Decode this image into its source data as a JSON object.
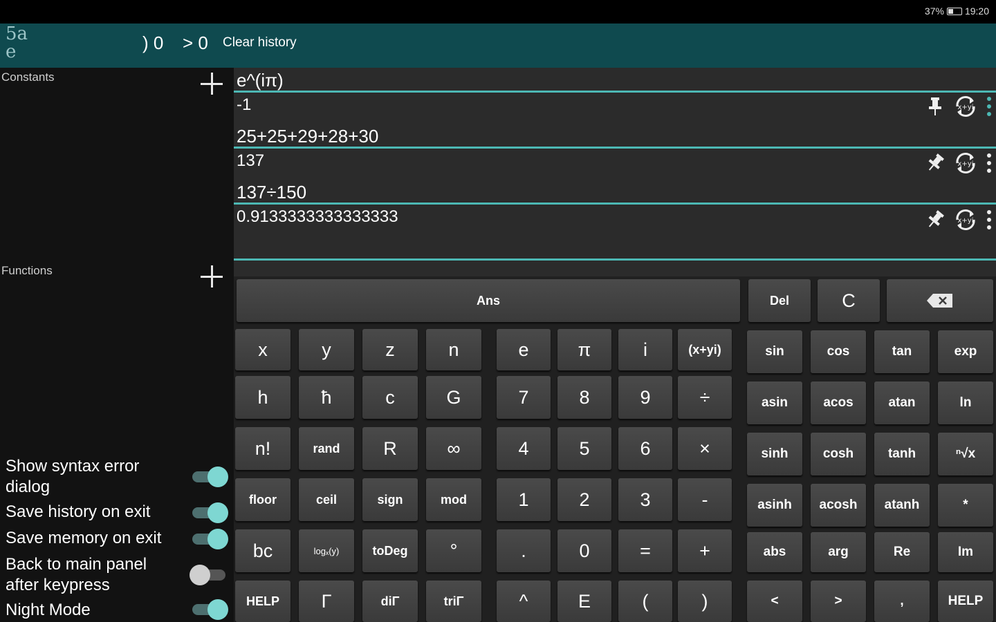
{
  "status": {
    "battery": "37%",
    "time": "19:20"
  },
  "toolbar": {
    "logo_line1": "5a",
    "logo_line2": "e",
    "paren_counter": ") 0",
    "greater_counter": "> 0",
    "clear_history": "Clear history"
  },
  "drawer": {
    "constants_title": "Constants",
    "functions_title": "Functions",
    "settings": [
      {
        "label": "Show syntax error dialog",
        "on": true
      },
      {
        "label": "Save history on exit",
        "on": true
      },
      {
        "label": "Save memory on exit",
        "on": true
      },
      {
        "label": "Back to main panel after keypress",
        "on": false
      },
      {
        "label": "Night Mode",
        "on": true
      }
    ]
  },
  "history": [
    {
      "expr": "e^(iπ)",
      "result": "-1",
      "pinned": true
    },
    {
      "expr": "25+25+29+28+30",
      "result": "137",
      "pinned": false
    },
    {
      "expr": "137÷150",
      "result": "0.9133333333333333",
      "pinned": false
    }
  ],
  "keypad": {
    "top": {
      "ans": "Ans",
      "del": "Del",
      "clear": "C",
      "backspace": "backspace"
    },
    "main": [
      [
        "x",
        "y",
        "z",
        "n",
        "e",
        "π",
        "i",
        "(x+yi)"
      ],
      [
        "h",
        "ħ",
        "c",
        "G",
        "7",
        "8",
        "9",
        "÷"
      ],
      [
        "n!",
        "rand",
        "R",
        "∞",
        "4",
        "5",
        "6",
        "×"
      ],
      [
        "floor",
        "ceil",
        "sign",
        "mod",
        "1",
        "2",
        "3",
        "-"
      ],
      [
        "bc",
        "logₓ(y)",
        "toDeg",
        "°",
        ".",
        "0",
        "=",
        "+"
      ],
      [
        "HELP",
        "Γ",
        "diΓ",
        "triΓ",
        "^",
        "E",
        "(",
        ")"
      ]
    ],
    "fn": [
      [
        "sin",
        "cos",
        "tan",
        "exp"
      ],
      [
        "asin",
        "acos",
        "atan",
        "ln"
      ],
      [
        "sinh",
        "cosh",
        "tanh",
        "ⁿ√x"
      ],
      [
        "asinh",
        "acosh",
        "atanh",
        "*"
      ],
      [
        "abs",
        "arg",
        "Re",
        "Im"
      ],
      [
        "<",
        ">",
        ",",
        "HELP"
      ]
    ]
  }
}
